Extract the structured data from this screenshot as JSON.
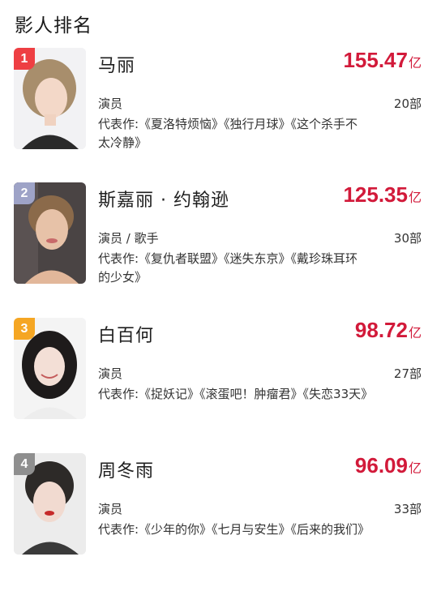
{
  "header": {
    "title": "影人排名"
  },
  "colors": {
    "box_office": "#d21a3a",
    "rank_1": "#ee3f43",
    "rank_2": "#9ea3c7",
    "rank_3": "#f5a623",
    "rank_4": "#8f8f8f"
  },
  "people": [
    {
      "rank": "1",
      "name": "马丽",
      "box_office": "155.47",
      "box_unit": "亿",
      "role": "演员",
      "works_count": "20部",
      "works": "代表作:《夏洛特烦恼》《独行月球》《这个杀手不太冷静》",
      "photo_icon": "portrait-photo"
    },
    {
      "rank": "2",
      "name": "斯嘉丽 · 约翰逊",
      "box_office": "125.35",
      "box_unit": "亿",
      "role": "演员 / 歌手",
      "works_count": "30部",
      "works": "代表作:《复仇者联盟》《迷失东京》《戴珍珠耳环的少女》",
      "photo_icon": "portrait-photo"
    },
    {
      "rank": "3",
      "name": "白百何",
      "box_office": "98.72",
      "box_unit": "亿",
      "role": "演员",
      "works_count": "27部",
      "works": "代表作:《捉妖记》《滚蛋吧！肿瘤君》《失恋33天》",
      "photo_icon": "portrait-photo"
    },
    {
      "rank": "4",
      "name": "周冬雨",
      "box_office": "96.09",
      "box_unit": "亿",
      "role": "演员",
      "works_count": "33部",
      "works": "代表作:《少年的你》《七月与安生》《后来的我们》",
      "photo_icon": "portrait-photo"
    }
  ]
}
